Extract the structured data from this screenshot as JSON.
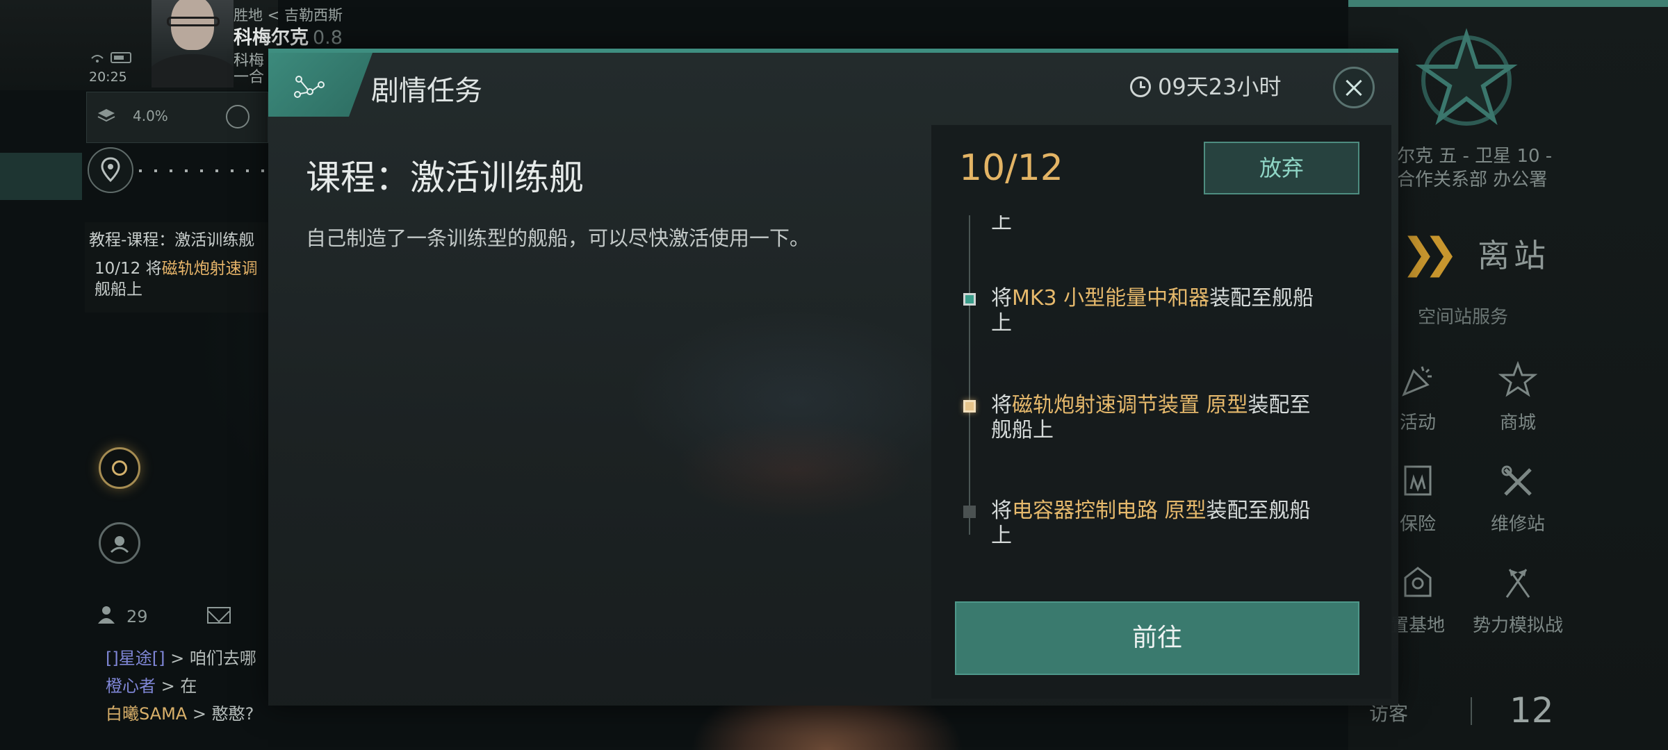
{
  "hud": {
    "location_small": "胜地 < 吉勒西斯",
    "pilot_name": "科梅尔克",
    "pilot_sec": "0.8",
    "corp_cut": "科梅\n一合",
    "clock": "20:25",
    "capacity_pct": "4.0%",
    "task_title": "教程-课程：激活训练舰",
    "task_step_prefix": "10/12 将",
    "task_step_highlight": "磁轨炮射速调",
    "task_step_suffix": "舰船上",
    "online_count": "29",
    "chat": [
      {
        "who": "[]星途[]",
        "msg": " > 咱们去哪"
      },
      {
        "who": "橙心者",
        "msg": " > 在"
      },
      {
        "who": "白曦SAMA",
        "msg": " > 憨憨?"
      }
    ]
  },
  "station": {
    "name_line1": "尔克 五 - 卫星 10 -",
    "name_line2": "合作关系部 办公署",
    "undock_label": "离站",
    "services_header": "空间站服务",
    "services": [
      {
        "label": "活动",
        "icon": "party-popper-icon"
      },
      {
        "label": "商城",
        "icon": "shop-icon"
      },
      {
        "label": "保险",
        "icon": "insurance-icon"
      },
      {
        "label": "维修站",
        "icon": "repair-tools-icon"
      },
      {
        "label": "置基地",
        "icon": "base-icon"
      },
      {
        "label": "势力模拟战",
        "icon": "crossed-flags-icon"
      }
    ],
    "visitor_label": "访客",
    "visitor_count": "12"
  },
  "modal": {
    "title": "剧情任务",
    "timer": "09天23小时",
    "course_title": "课程：激活训练舰",
    "course_desc": "自己制造了一条训练型的舰船，可以尽快激活使用一下。",
    "progress": "10/12",
    "abandon_label": "放弃",
    "go_label": "前往",
    "steps": [
      {
        "prefix": "",
        "highlight": "",
        "suffix": "上",
        "state": "done"
      },
      {
        "prefix": "将",
        "highlight": "MK3 小型能量中和器",
        "suffix": "装配至舰船上",
        "state": "done"
      },
      {
        "prefix": "将",
        "highlight": "磁轨炮射速调节装置 原型",
        "suffix": "装配至舰船上",
        "state": "active"
      },
      {
        "prefix": "将",
        "highlight": "电容器控制电路 原型",
        "suffix": "装配至舰船上",
        "state": "todo"
      }
    ]
  },
  "colors": {
    "accent_teal": "#3e8e80",
    "highlight_gold": "#e6b96c",
    "progress_gold": "#e3b465"
  }
}
